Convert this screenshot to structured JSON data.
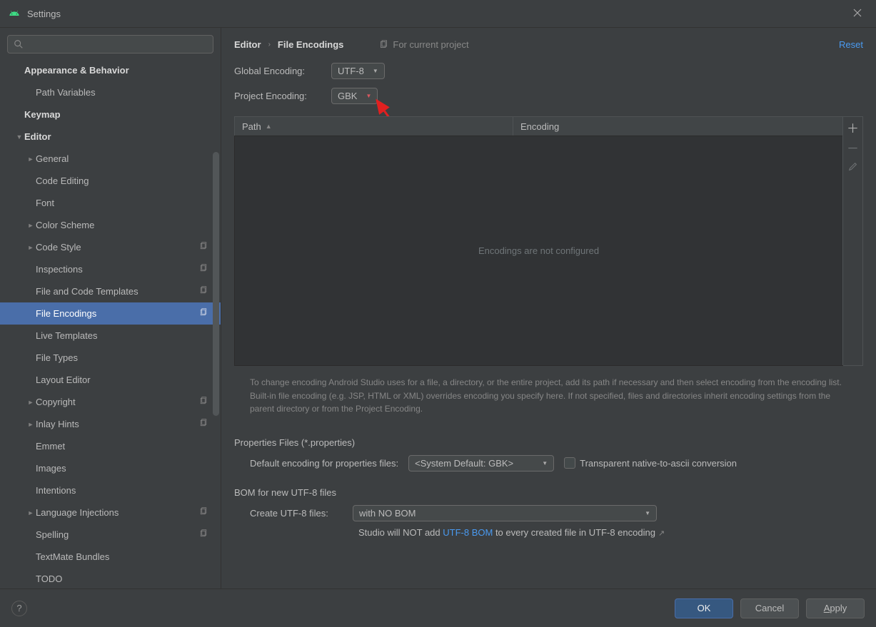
{
  "window": {
    "title": "Settings"
  },
  "search": {
    "placeholder": ""
  },
  "tree": {
    "items": [
      {
        "label": "Appearance & Behavior",
        "lvl": 0,
        "bold": true,
        "chev": ""
      },
      {
        "label": "Path Variables",
        "lvl": 1
      },
      {
        "label": "Keymap",
        "lvl": 0,
        "bold": true
      },
      {
        "label": "Editor",
        "lvl": 0,
        "bold": true,
        "chev": "▼"
      },
      {
        "label": "General",
        "lvl": 1,
        "chev": "►"
      },
      {
        "label": "Code Editing",
        "lvl": 1
      },
      {
        "label": "Font",
        "lvl": 1
      },
      {
        "label": "Color Scheme",
        "lvl": 1,
        "chev": "►"
      },
      {
        "label": "Code Style",
        "lvl": 1,
        "chev": "►",
        "badge": true
      },
      {
        "label": "Inspections",
        "lvl": 1,
        "badge": true
      },
      {
        "label": "File and Code Templates",
        "lvl": 1,
        "badge": true
      },
      {
        "label": "File Encodings",
        "lvl": 1,
        "badge": true,
        "selected": true
      },
      {
        "label": "Live Templates",
        "lvl": 1
      },
      {
        "label": "File Types",
        "lvl": 1
      },
      {
        "label": "Layout Editor",
        "lvl": 1
      },
      {
        "label": "Copyright",
        "lvl": 1,
        "chev": "►",
        "badge": true
      },
      {
        "label": "Inlay Hints",
        "lvl": 1,
        "chev": "►",
        "badge": true
      },
      {
        "label": "Emmet",
        "lvl": 1
      },
      {
        "label": "Images",
        "lvl": 1
      },
      {
        "label": "Intentions",
        "lvl": 1
      },
      {
        "label": "Language Injections",
        "lvl": 1,
        "chev": "►",
        "badge": true
      },
      {
        "label": "Spelling",
        "lvl": 1,
        "badge": true
      },
      {
        "label": "TextMate Bundles",
        "lvl": 1
      },
      {
        "label": "TODO",
        "lvl": 1
      }
    ]
  },
  "crumbs": {
    "root": "Editor",
    "leaf": "File Encodings",
    "scope": "For current project",
    "reset": "Reset"
  },
  "form": {
    "global_label": "Global Encoding:",
    "global_value": "UTF-8",
    "project_label": "Project Encoding:",
    "project_value": "GBK"
  },
  "table": {
    "col_path": "Path",
    "col_enc": "Encoding",
    "empty": "Encodings are not configured"
  },
  "help_text": "To change encoding Android Studio uses for a file, a directory, or the entire project, add its path if necessary and then select encoding from the encoding list. Built-in file encoding (e.g. JSP, HTML or XML) overrides encoding you specify here. If not specified, files and directories inherit encoding settings from the parent directory or from the Project Encoding.",
  "props": {
    "heading": "Properties Files (*.properties)",
    "default_label": "Default encoding for properties files:",
    "default_value": "<System Default: GBK>",
    "checkbox_label": "Transparent native-to-ascii conversion"
  },
  "bom": {
    "heading": "BOM for new UTF-8 files",
    "create_label": "Create UTF-8 files:",
    "create_value": "with NO BOM",
    "hint_pre": "Studio will NOT add ",
    "hint_link": "UTF-8 BOM",
    "hint_post": " to every created file in UTF-8 encoding"
  },
  "buttons": {
    "ok": "OK",
    "cancel": "Cancel",
    "apply": "Apply"
  }
}
